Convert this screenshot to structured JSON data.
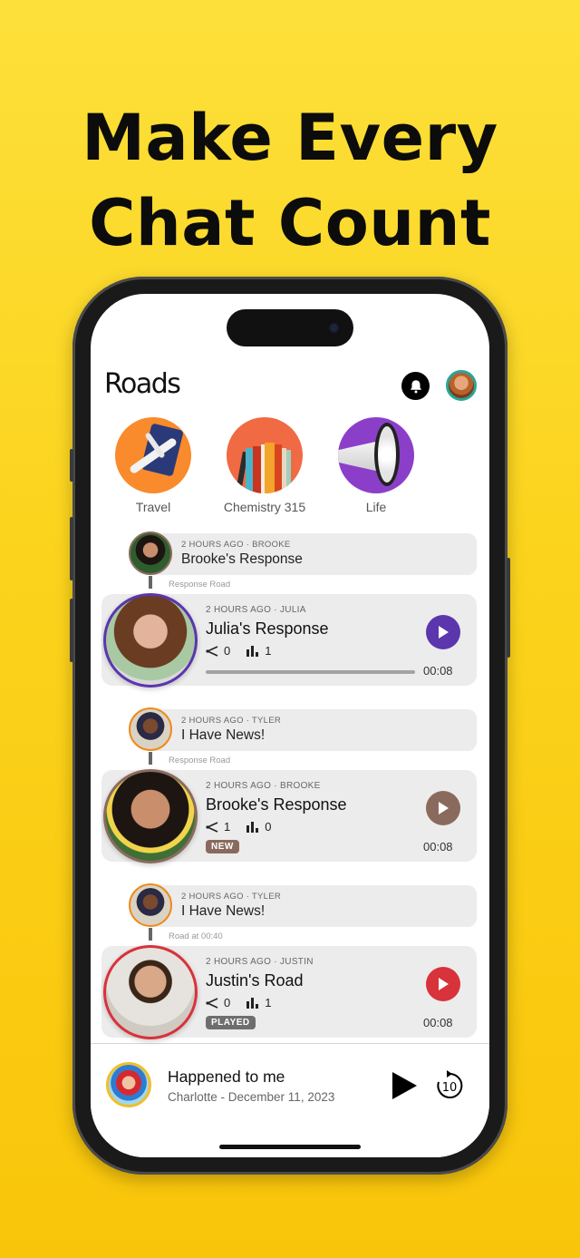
{
  "headline": {
    "line1": "Make Every",
    "line2": "Chat Count"
  },
  "app": {
    "logo": "Roads",
    "header_icons": {
      "notifications": "bell-icon",
      "profile": "user-avatar"
    }
  },
  "categories": [
    {
      "label": "Travel",
      "icon": "airplane-passport-image",
      "color": "#f98b2c"
    },
    {
      "label": "Chemistry 315",
      "icon": "books-image",
      "color": "#f06a43"
    },
    {
      "label": "Life",
      "icon": "megaphone-image",
      "color": "#8b3fc9"
    }
  ],
  "threads": [
    {
      "parent": {
        "meta": "2 HOURS AGO · BROOKE",
        "title": "Brooke's Response",
        "ring_color": "#8a6b5e"
      },
      "road_label": "Response Road",
      "child": {
        "meta": "2 HOURS AGO · JULIA",
        "title": "Julia's Response",
        "shares": "0",
        "listens": "1",
        "duration": "00:08",
        "accent": "#5b36ad",
        "status": "playing",
        "progress": 0,
        "badge": null
      }
    },
    {
      "parent": {
        "meta": "2 HOURS AGO · TYLER",
        "title": "I Have News!",
        "ring_color": "#f08a1c"
      },
      "road_label": "Response Road",
      "child": {
        "meta": "2 HOURS AGO · BROOKE",
        "title": "Brooke's Response",
        "shares": "1",
        "listens": "0",
        "duration": "00:08",
        "accent": "#8b6a5e",
        "badge": "NEW",
        "badge_color": "#8b6a5e"
      }
    },
    {
      "parent": {
        "meta": "2 HOURS AGO · TYLER",
        "title": "I Have News!",
        "ring_color": "#f08a1c"
      },
      "road_label": "Road at 00:40",
      "child": {
        "meta": "2 HOURS AGO · JUSTIN",
        "title": "Justin's Road",
        "shares": "0",
        "listens": "1",
        "duration": "00:08",
        "accent": "#d8323a",
        "badge": "PLAYED",
        "badge_color": "#6e6e6e"
      }
    }
  ],
  "mini_player": {
    "title": "Happened to me",
    "subtitle": "Charlotte - December 11, 2023",
    "play_icon": "play-icon",
    "skip_label": "10"
  }
}
